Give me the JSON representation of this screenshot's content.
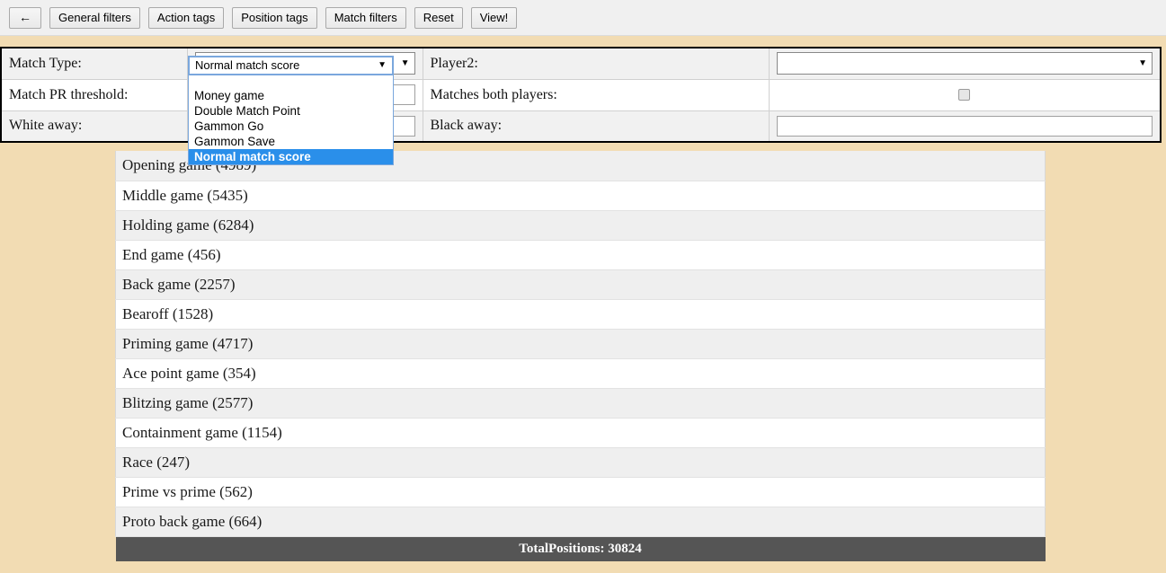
{
  "toolbar": {
    "back_label": "←",
    "buttons": [
      {
        "label": "General filters"
      },
      {
        "label": "Action tags"
      },
      {
        "label": "Position tags"
      },
      {
        "label": "Match filters"
      },
      {
        "label": "Reset"
      },
      {
        "label": "View!"
      }
    ]
  },
  "filters": {
    "rows": [
      {
        "left_label": "Match Type:",
        "right_label": "Player2:"
      },
      {
        "left_label": "Match PR threshold:",
        "right_label": "Matches both players:"
      },
      {
        "left_label": "White away:",
        "right_label": "Black away:"
      }
    ],
    "match_type_value": "Normal match score",
    "match_pr_threshold_value": "",
    "white_away_value": "",
    "player2_value": "",
    "black_away_value": "",
    "matches_both_players_checked": false,
    "select_arrow": "▼"
  },
  "dropdown": {
    "open": true,
    "selected": "Normal match score",
    "arrow": "▼",
    "options": [
      {
        "label": "",
        "selected": false
      },
      {
        "label": "Money game",
        "selected": false
      },
      {
        "label": "Double Match Point",
        "selected": false
      },
      {
        "label": "Gammon Go",
        "selected": false
      },
      {
        "label": "Gammon Save",
        "selected": false
      },
      {
        "label": "Normal match score",
        "selected": true
      }
    ]
  },
  "position_list": {
    "items": [
      {
        "label": "Opening game (4989)"
      },
      {
        "label": "Middle game (5435)"
      },
      {
        "label": "Holding game (6284)"
      },
      {
        "label": "End game (456)"
      },
      {
        "label": "Back game (2257)"
      },
      {
        "label": "Bearoff (1528)"
      },
      {
        "label": "Priming game (4717)"
      },
      {
        "label": "Ace point game (354)"
      },
      {
        "label": "Blitzing game (2577)"
      },
      {
        "label": "Containment game (1154)"
      },
      {
        "label": "Race (247)"
      },
      {
        "label": "Prime vs prime (562)"
      },
      {
        "label": "Proto back game (664)"
      }
    ],
    "total_label": "TotalPositions: 30824"
  },
  "colors": {
    "page_background": "#f2dcb3",
    "toolbar_background": "#f0f0f0",
    "highlight": "#2a8fea",
    "total_bar": "#555555"
  }
}
